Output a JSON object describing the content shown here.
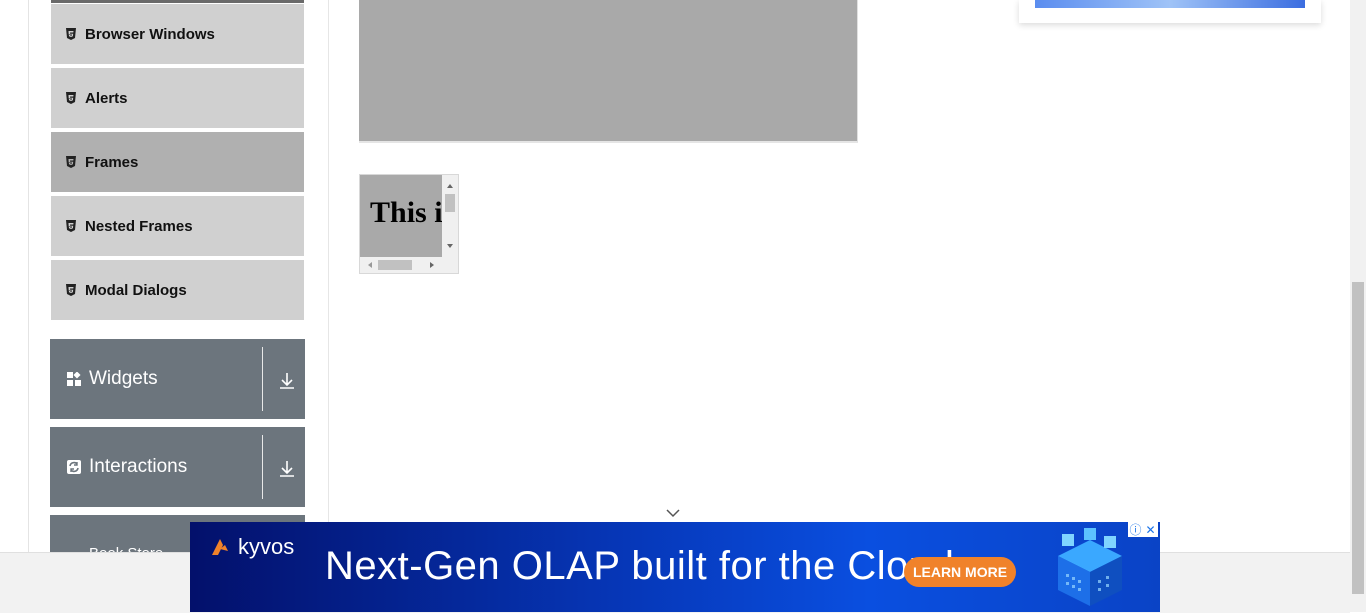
{
  "sidebar": {
    "items": [
      {
        "label": "Browser Windows",
        "icon": "html5-icon",
        "active": false
      },
      {
        "label": "Alerts",
        "icon": "html5-icon",
        "active": false
      },
      {
        "label": "Frames",
        "icon": "html5-icon",
        "active": true
      },
      {
        "label": "Nested Frames",
        "icon": "html5-icon",
        "active": false
      },
      {
        "label": "Modal Dialogs",
        "icon": "html5-icon",
        "active": false
      }
    ],
    "groups": [
      {
        "label": "Widgets",
        "icon": "widgets-icon"
      },
      {
        "label": "Interactions",
        "icon": "interactions-icon"
      },
      {
        "label": "Book Store"
      }
    ]
  },
  "frames": {
    "small_frame_text": "This is a"
  },
  "ad": {
    "brand": "kyvos",
    "headline": "Next-Gen OLAP built for the Cloud",
    "cta": "LEARN MORE",
    "info_glyph": "ⓘ",
    "close_glyph": "✕"
  },
  "colors": {
    "menu_bg": "#d0d0d0",
    "menu_active_bg": "#b0b0b0",
    "group_bg": "#6c757d",
    "frame_bg": "#a9a9a9",
    "cta": "#f0822a"
  }
}
